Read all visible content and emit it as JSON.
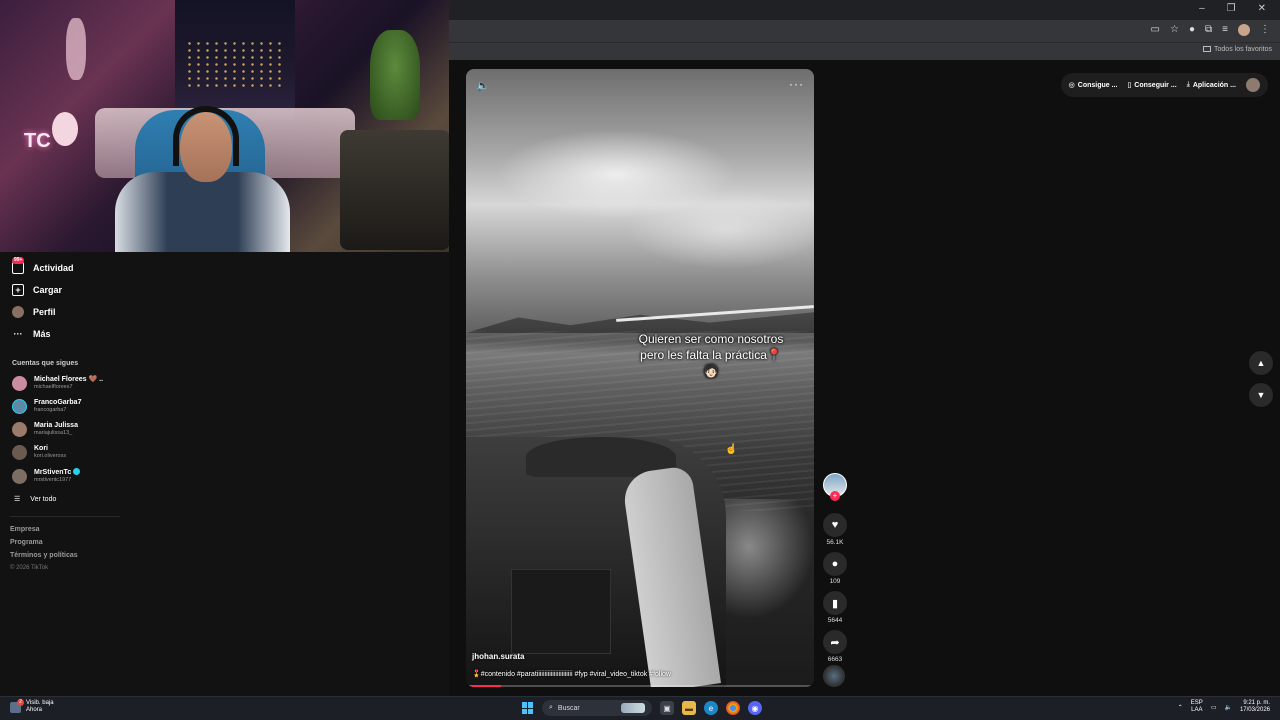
{
  "browser": {
    "window_controls": [
      "–",
      "❐",
      "✕"
    ],
    "bookmarks_folder": "Todos los favoritos"
  },
  "sidebar": {
    "nav": [
      {
        "label": "Actividad",
        "icon": "inbox-icon",
        "badge": "99+"
      },
      {
        "label": "Cargar",
        "icon": "upload-icon"
      },
      {
        "label": "Perfil",
        "icon": "profile-avatar-icon"
      },
      {
        "label": "Más",
        "icon": "more-dots-icon"
      }
    ],
    "following_title": "Cuentas que sigues",
    "following": [
      {
        "name": "Michael Florees 🤎 ..",
        "handle": "michaelflorees7"
      },
      {
        "name": "FrancoGarba7",
        "handle": "francogarba7"
      },
      {
        "name": "Maria Julissa",
        "handle": "mariajulissa13_"
      },
      {
        "name": "Kori",
        "handle": "kori.oliveross"
      },
      {
        "name": "MrStivenTc",
        "handle": "mrstiventc1977",
        "verified": true
      }
    ],
    "see_all": "Ver todo",
    "footer_links": [
      "Empresa",
      "Programa",
      "Términos y políticas"
    ],
    "copyright": "© 2026 TikTok"
  },
  "header_pills": {
    "items": [
      "Consigue ...",
      "Conseguir ...",
      "Aplicación ..."
    ]
  },
  "video": {
    "caption": "Quieren ser como nosotros pero les falta la práctica📍🧑🏻",
    "username": "jhohan.surata",
    "hashtags": "🎖️#contenido #paratiiiiiiiiiiiiiiiiiiiiiii #fyp #viral_video_tiktok #follow",
    "progress": 0.1
  },
  "actions": {
    "likes": "56.1K",
    "comments": "109",
    "saves": "5644",
    "shares": "6663"
  },
  "taskbar": {
    "weather_title": "Visib. baja",
    "weather_sub": "Ahora",
    "weather_badge": "2",
    "search_placeholder": "Buscar",
    "lang_top": "ESP",
    "lang_bottom": "LAA",
    "time": "9:21 p. m.",
    "date": "17/03/2026"
  }
}
